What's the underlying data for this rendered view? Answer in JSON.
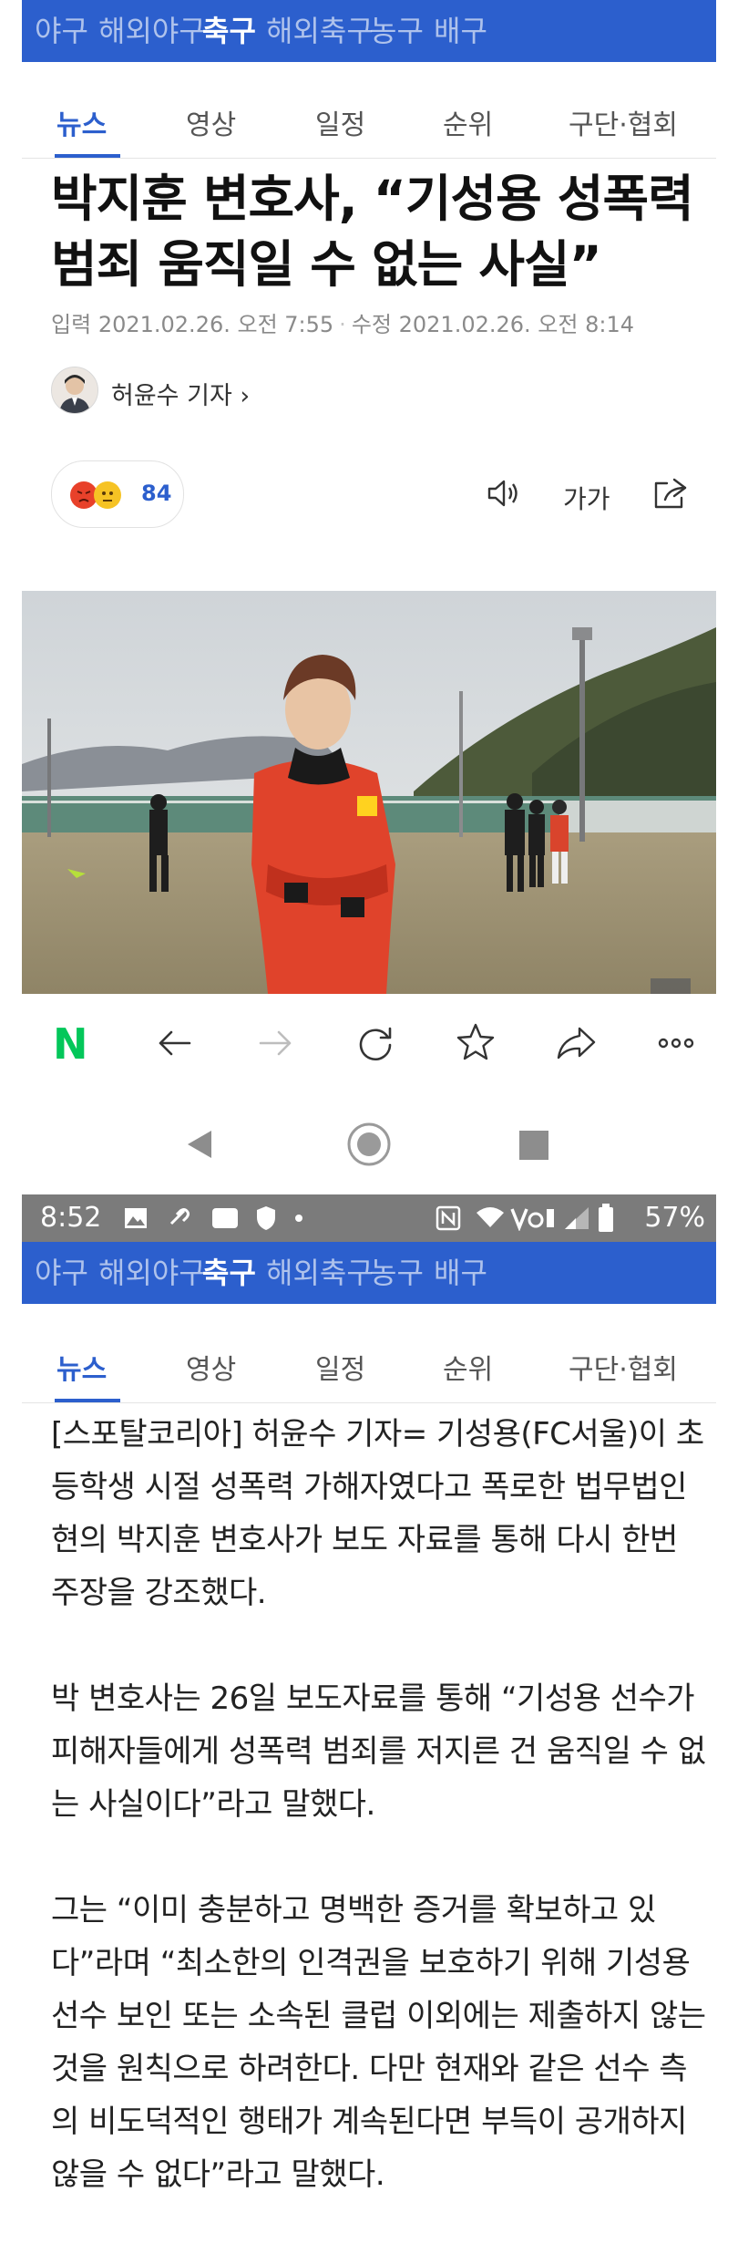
{
  "categories": [
    "야구",
    "해외야구",
    "축구",
    "해외축구",
    "농구",
    "배구"
  ],
  "active_category": "축구",
  "tabs": [
    "뉴스",
    "영상",
    "일정",
    "순위",
    "구단·협회"
  ],
  "active_tab": "뉴스",
  "article": {
    "headline_line1": "박지훈 변호사, “기성용 성폭력",
    "headline_line2": "범죄 움직일 수 없는 사실”",
    "input_label": "입력",
    "input_time": "2021.02.26. 오전 7:55",
    "edit_label": "수정",
    "edit_time": "2021.02.26. 오전 8:14",
    "reporter": "허윤수 기자",
    "reporter_chevron": "›",
    "reaction_count": "84",
    "font_size_label": "가가",
    "paragraphs": [
      "[스포탈코리아] 허윤수 기자= 기성용(FC서울)이 초등학생 시절 성폭력 가해자였다고 폭로한 법무법인 현의 박지훈 변호사가 보도 자료를 통해 다시 한번 주장을 강조했다.",
      "박 변호사는 26일 보도자료를 통해 “기성용 선수가 피해자들에게 성폭력 범죄를 저지른 건 움직일 수 없는 사실이다”라고 말했다.",
      "그는 “이미 충분하고 명백한 증거를 확보하고 있다”라며 “최소한의 인격권을 보호하기 위해 기성용 선수 보인 또는 소속된 클럽 이외에는 제출하지 않는 것을 원칙으로 하려한다. 다만 현재와 같은 선수 측의 비도덕적인 행태가 계속된다면 부득이 공개하지 않을 수 없다”라고 말했다."
    ]
  },
  "browser": {
    "logo": "N"
  },
  "status_bar": {
    "time": "8:52",
    "battery": "57%"
  },
  "colors": {
    "nav_blue": "#2c5fcd",
    "naver_green": "#03c75a",
    "status_gray": "#7b7b7b"
  },
  "icons": [
    "speaker-icon",
    "font-size-icon",
    "share-icon",
    "back-arrow-icon",
    "forward-arrow-icon",
    "reload-icon",
    "bookmark-star-icon",
    "send-icon",
    "more-icon"
  ]
}
